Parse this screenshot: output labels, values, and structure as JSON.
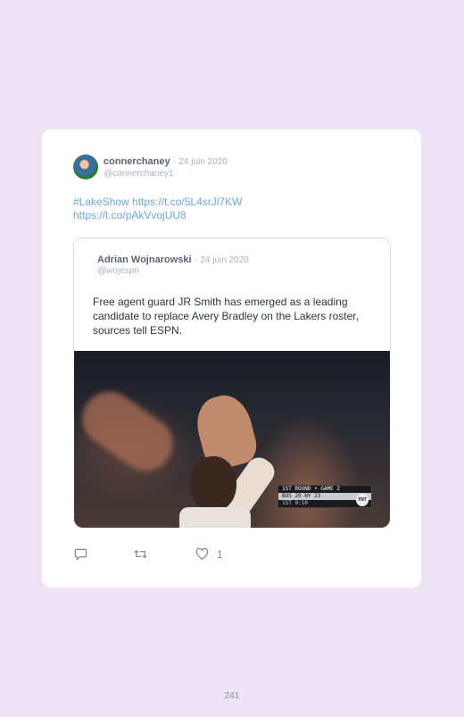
{
  "tweet": {
    "author_name": "connerchaney",
    "date_separator": "·",
    "date": "24 juin 2020",
    "handle": "@connerchaney1",
    "text_line1": "#LakeShow https://t.co/5L4srJl7KW",
    "text_line2": "https://t.co/pAkVvojUU8"
  },
  "quote": {
    "author_name": "Adrian Wojnarowski",
    "date_separator": "·",
    "date": "24 juin 2020",
    "handle": "@wojespn",
    "text": "Free agent guard JR Smith has emerged as a leading candidate to replace Avery Bradley on the Lakers roster, sources tell ESPN."
  },
  "media": {
    "scorebug_header": "1ST ROUND • GAME 2",
    "scorebug_scores": "BOS 20  NY 23",
    "scorebug_footer": "1ST  9:10",
    "network": "TNT"
  },
  "actions": {
    "reply_icon": "reply-icon",
    "retweet_icon": "retweet-icon",
    "like_icon": "heart-icon",
    "like_count": "1"
  },
  "page_number": "241",
  "colors": {
    "background": "#efe3f6",
    "link": "#6aa7dc",
    "muted": "#aab3bd"
  }
}
